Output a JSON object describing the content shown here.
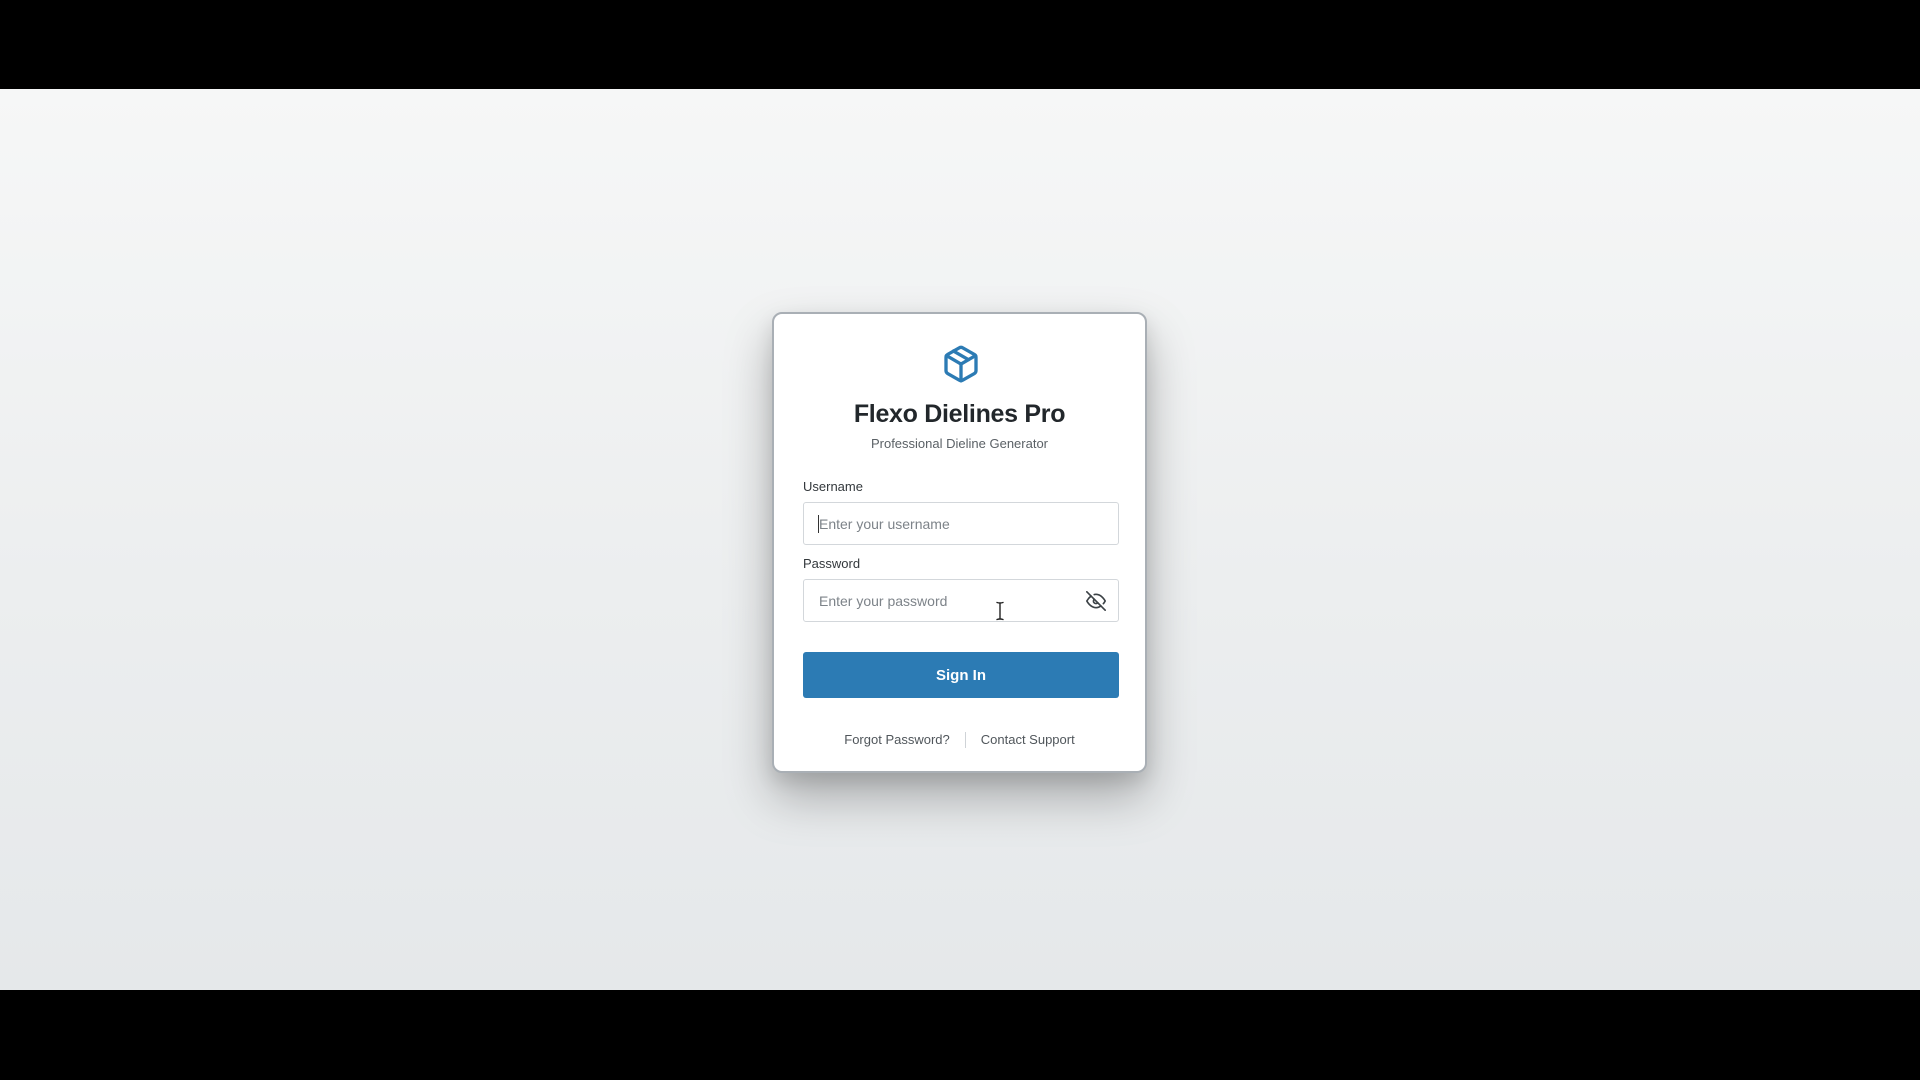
{
  "app": {
    "title": "Flexo Dielines Pro",
    "subtitle": "Professional Dieline Generator",
    "logo_icon": "package-box-icon",
    "accent_color": "#2c7bb4"
  },
  "form": {
    "username": {
      "label": "Username",
      "placeholder": "Enter your username",
      "value": ""
    },
    "password": {
      "label": "Password",
      "placeholder": "Enter your password",
      "value": "",
      "toggle_icon": "eye-off-icon"
    },
    "submit_label": "Sign In"
  },
  "links": {
    "forgot_password": "Forgot Password?",
    "contact_support": "Contact Support"
  }
}
